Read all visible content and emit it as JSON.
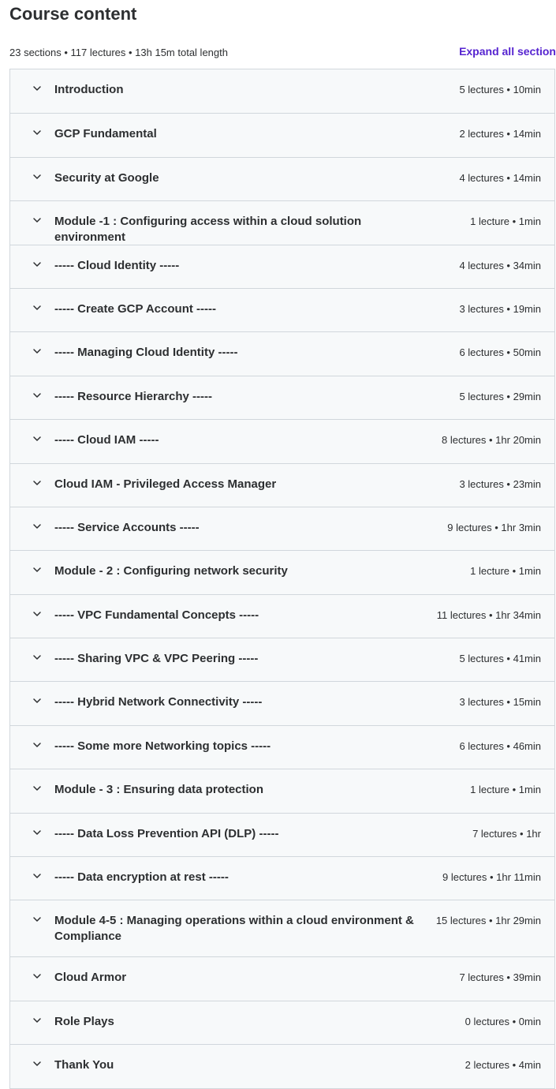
{
  "header": {
    "title": "Course content",
    "summary": "23 sections • 117 lectures • 13h 15m total length",
    "expand_all_label": "Expand all section"
  },
  "icons": {
    "section_toggle": "chevron-down-icon"
  },
  "colors": {
    "accent": "#5624d0",
    "section_bg": "#f7f9fa",
    "border": "#d1d7dc",
    "text": "#2d2f31"
  },
  "sections": [
    {
      "title": "Introduction",
      "meta": "5 lectures • 10min"
    },
    {
      "title": "GCP Fundamental",
      "meta": "2 lectures • 14min"
    },
    {
      "title": "Security at Google",
      "meta": "4 lectures • 14min"
    },
    {
      "title": "Module -1 : Configuring access within a cloud solution environment",
      "meta": "1 lecture • 1min"
    },
    {
      "title": "----- Cloud Identity -----",
      "meta": "4 lectures • 34min"
    },
    {
      "title": "----- Create GCP Account -----",
      "meta": "3 lectures • 19min"
    },
    {
      "title": "----- Managing Cloud Identity -----",
      "meta": "6 lectures • 50min"
    },
    {
      "title": "----- Resource Hierarchy -----",
      "meta": "5 lectures • 29min"
    },
    {
      "title": "----- Cloud IAM -----",
      "meta": "8 lectures • 1hr 20min"
    },
    {
      "title": "Cloud IAM - Privileged Access Manager",
      "meta": "3 lectures • 23min"
    },
    {
      "title": "----- Service Accounts -----",
      "meta": "9 lectures • 1hr 3min"
    },
    {
      "title": "Module - 2 : Configuring network security",
      "meta": "1 lecture • 1min"
    },
    {
      "title": "----- VPC Fundamental Concepts -----",
      "meta": "11 lectures • 1hr 34min"
    },
    {
      "title": "----- Sharing VPC & VPC Peering -----",
      "meta": "5 lectures • 41min"
    },
    {
      "title": "----- Hybrid Network Connectivity -----",
      "meta": "3 lectures • 15min"
    },
    {
      "title": "----- Some more Networking topics -----",
      "meta": "6 lectures • 46min"
    },
    {
      "title": "Module - 3 : Ensuring data protection",
      "meta": "1 lecture • 1min"
    },
    {
      "title": "----- Data Loss Prevention API (DLP) -----",
      "meta": "7 lectures • 1hr"
    },
    {
      "title": "----- Data encryption at rest -----",
      "meta": "9 lectures • 1hr 11min"
    },
    {
      "title": "Module 4-5 : Managing operations within a cloud environment & Compliance",
      "meta": "15 lectures • 1hr 29min"
    },
    {
      "title": "Cloud Armor",
      "meta": "7 lectures • 39min"
    },
    {
      "title": "Role Plays",
      "meta": "0 lectures • 0min"
    },
    {
      "title": "Thank You",
      "meta": "2 lectures • 4min"
    }
  ]
}
